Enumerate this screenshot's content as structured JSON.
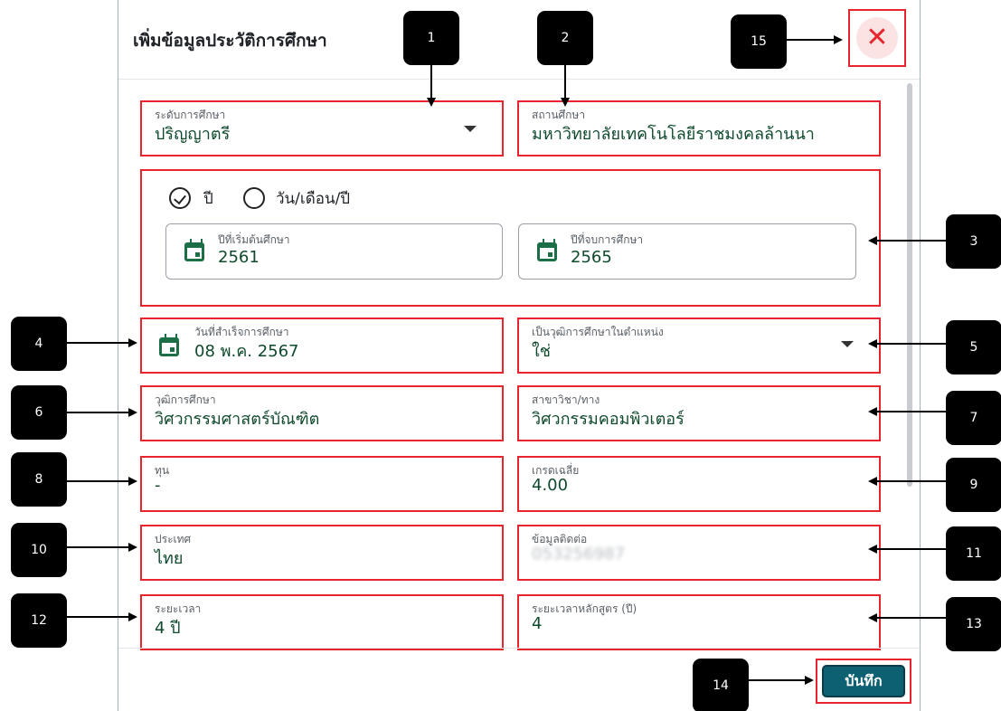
{
  "dialog": {
    "title": "เพิ่มข้อมูลประวัติการศึกษา"
  },
  "fields": {
    "level": {
      "label": "ระดับการศึกษา",
      "value": "ปริญญาตรี"
    },
    "institution": {
      "label": "สถานศึกษา",
      "value": "มหาวิทยาลัยเทคโนโลยีราชมงคลล้านนา"
    },
    "period": {
      "option_year": "ปี",
      "option_date": "วัน/เดือน/ปี",
      "selected": "ปี",
      "start": {
        "label": "ปีที่เริ่มต้นศึกษา",
        "value": "2561"
      },
      "end": {
        "label": "ปีที่จบการศึกษา",
        "value": "2565"
      }
    },
    "grad_date": {
      "label": "วันที่สำเร็จการศึกษา",
      "value": "08 พ.ค. 2567"
    },
    "qualification_for_position": {
      "label": "เป็นวุฒิการศึกษาในตำแหน่ง",
      "value": "ใช่"
    },
    "degree": {
      "label": "วุฒิการศึกษา",
      "value": "วิศวกรรมศาสตร์บัณฑิต"
    },
    "major": {
      "label": "สาขาวิชา/ทาง",
      "value": "วิศวกรรมคอมพิวเตอร์"
    },
    "scholarship": {
      "label": "ทุน",
      "value": "-"
    },
    "gpa": {
      "label": "เกรดเฉลี่ย",
      "value": "4.00"
    },
    "country": {
      "label": "ประเทศ",
      "value": "ไทย"
    },
    "contact": {
      "label": "ข้อมูลติดต่อ",
      "value": "053256987"
    },
    "duration": {
      "label": "ระยะเวลา",
      "value": "4 ปี"
    },
    "course_duration": {
      "label": "ระยะเวลาหลักสูตร (ปี)",
      "value": "4"
    }
  },
  "footer": {
    "save_label": "บันทึก"
  },
  "close_label": "✕",
  "annotations": [
    "1",
    "2",
    "3",
    "4",
    "5",
    "6",
    "7",
    "8",
    "9",
    "10",
    "11",
    "12",
    "13",
    "14",
    "15"
  ],
  "colors": {
    "highlight": "#e8252c",
    "value_text": "#0f4a2c",
    "save_button": "#0d5f72"
  }
}
